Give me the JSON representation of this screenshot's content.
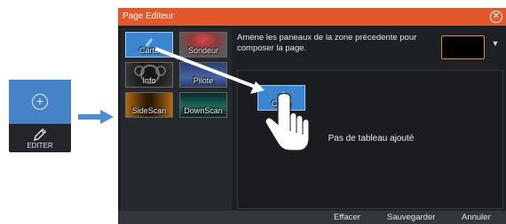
{
  "side_widget": {
    "add_icon": "plus-circle-icon",
    "edit_icon": "pencil-icon",
    "edit_label": "EDITER",
    "colors": {
      "add_bg": "#4582c8",
      "body_bg": "#23252a"
    }
  },
  "transition_arrow": {
    "icon": "right-arrow-icon",
    "color": "#4a8fd4"
  },
  "dialog": {
    "title": "Page Editeur",
    "close_icon": "close-icon",
    "colors": {
      "titlebar": "#e2582a",
      "body": "#1d2024",
      "accent": "#e28b26"
    },
    "panels": [
      {
        "label": "Carte",
        "selected": true
      },
      {
        "label": "Sondeur"
      },
      {
        "label": "Info"
      },
      {
        "label": "Pilote"
      },
      {
        "label": "SideScan"
      },
      {
        "label": "DownScan"
      }
    ],
    "instruction": "Amène les paneaux de la zone précedente pour composer la page.",
    "color_picker_value": "#000000",
    "dropdown_icon": "chevron-down-icon",
    "drop_zone": {
      "empty_text": "Pas de tableau ajouté",
      "dragged_panel_label": "Carte"
    },
    "footer": {
      "clear": "Effacer",
      "save": "Sauvegarder",
      "cancel": "Annuler"
    }
  },
  "gesture": {
    "icon": "hand-pointer-icon",
    "drag_arrow_icon": "drag-arrow-icon"
  }
}
